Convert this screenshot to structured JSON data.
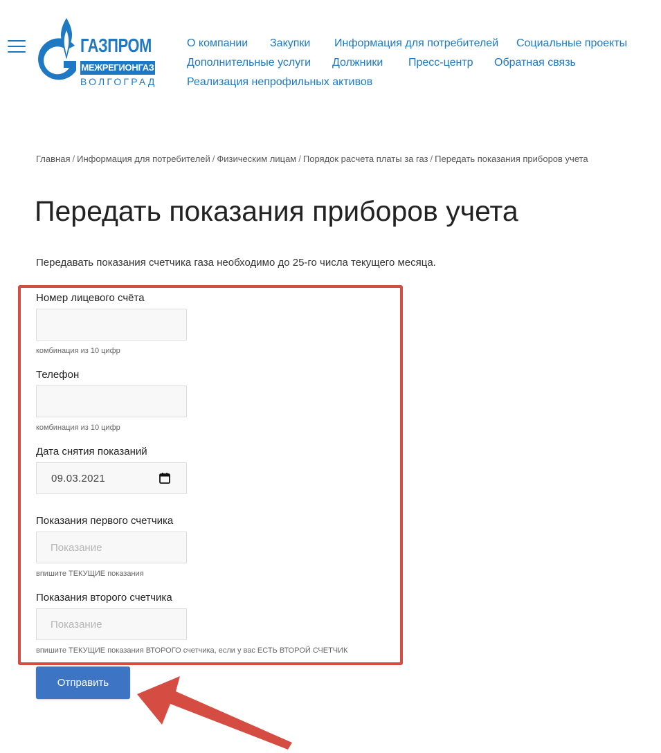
{
  "header": {
    "logo": {
      "word": "ГАЗПРОМ",
      "sub": "МЕЖРЕГИОНГАЗ",
      "city": "ВОЛГОГРАД"
    },
    "nav": [
      "О компании",
      "Закупки",
      "Информация для потребителей",
      "Социальные проекты",
      "Дополнительные услуги",
      "Должники",
      "Пресс-центр",
      "Обратная связь",
      "Реализация непрофильных активов"
    ]
  },
  "breadcrumb": [
    "Главная",
    "Информация для потребителей",
    "Физическим лицам",
    "Порядок расчета платы за газ",
    "Передать показания приборов учета"
  ],
  "breadcrumb_separator": "/",
  "page_title": "Передать показания приборов учета",
  "intro": "Передавать показания счетчика газа необходимо до 25-го числа текущего месяца.",
  "form": {
    "account": {
      "label": "Номер лицевого счёта",
      "value": "",
      "hint": "комбинация из 10 цифр"
    },
    "phone": {
      "label": "Телефон",
      "value": "",
      "hint": "комбинация из 10 цифр"
    },
    "date": {
      "label": "Дата снятия показаний",
      "value": "09.03.2021"
    },
    "meter1": {
      "label": "Показания первого счетчика",
      "placeholder": "Показание",
      "hint": "впишите ТЕКУЩИЕ показания"
    },
    "meter2": {
      "label": "Показания второго счетчика",
      "placeholder": "Показание",
      "hint": "впишите ТЕКУЩИЕ показания ВТОРОГО счетчика, если у вас ЕСТЬ ВТОРОЙ СЧЕТЧИК"
    },
    "submit_label": "Отправить"
  },
  "colors": {
    "brand_blue": "#1e78c2",
    "button_blue": "#3d74c4",
    "highlight_red": "#d54c43"
  }
}
